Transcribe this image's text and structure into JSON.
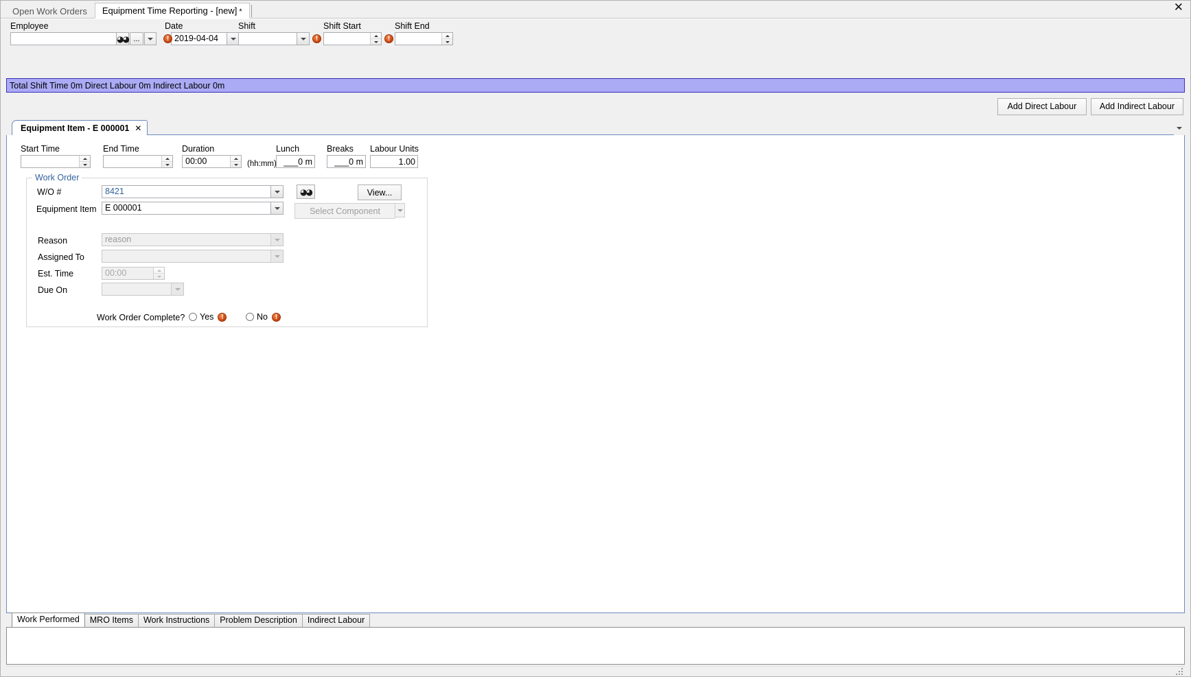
{
  "window": {
    "close_label": "✕"
  },
  "doc_tabs": [
    {
      "label": "Open Work Orders",
      "active": false
    },
    {
      "label": "Equipment Time Reporting - [new]",
      "star": "*",
      "active": true
    }
  ],
  "header": {
    "employee": {
      "label": "Employee",
      "value": "",
      "search_icon": "binoculars-icon",
      "ellipsis_label": "...",
      "dropdown_icon": "chevron-down-icon"
    },
    "date": {
      "label": "Date",
      "value": "2019-04-04",
      "error": "!"
    },
    "shift": {
      "label": "Shift",
      "value": "",
      "error": "!"
    },
    "shift_start": {
      "label": "Shift Start",
      "value": "",
      "error": "!"
    },
    "shift_end": {
      "label": "Shift End",
      "value": ""
    }
  },
  "summary": {
    "text": "Total Shift Time 0m  Direct Labour 0m  Indirect Labour 0m",
    "bg_color": "#aaaaf5",
    "border_color": "#3b2fb6"
  },
  "actions": {
    "add_direct_labour": "Add Direct Labour",
    "add_indirect_labour": "Add Indirect Labour"
  },
  "inner_tab": {
    "label": "Equipment Item - E 000001",
    "close_label": "✕",
    "overflow_icon": "chevron-down-icon"
  },
  "times": {
    "start_time": {
      "label": "Start Time",
      "value": ""
    },
    "end_time": {
      "label": "End Time",
      "value": ""
    },
    "duration": {
      "label": "Duration",
      "value": "00:00",
      "hint": "(hh:mm)"
    },
    "lunch": {
      "label": "Lunch",
      "value": "___0 m"
    },
    "breaks": {
      "label": "Breaks",
      "value": "___0 m"
    },
    "labour_units": {
      "label": "Labour Units",
      "value": "1.00"
    }
  },
  "work_order": {
    "title": "Work Order",
    "wo_number": {
      "label": "W/O #",
      "value": "8421",
      "value_color": "#31639c"
    },
    "search_icon": "binoculars-icon",
    "view_button": "View...",
    "equipment_item": {
      "label": "Equipment Item",
      "value": "E 000001"
    },
    "select_component": {
      "label": "Select Component",
      "disabled": true
    },
    "reason": {
      "label": "Reason",
      "value": "reason",
      "disabled": true
    },
    "assigned_to": {
      "label": "Assigned To",
      "value": "",
      "disabled": true
    },
    "est_time": {
      "label": "Est. Time",
      "value": "00:00",
      "disabled": true
    },
    "due_on": {
      "label": "Due On",
      "value": "",
      "disabled": true
    },
    "complete": {
      "label": "Work Order Complete?",
      "yes_label": "Yes",
      "no_label": "No",
      "yes_error": "!",
      "no_error": "!"
    }
  },
  "bottom_tabs": [
    {
      "label": "Work Performed",
      "active": true
    },
    {
      "label": "MRO Items",
      "active": false
    },
    {
      "label": "Work Instructions",
      "active": false
    },
    {
      "label": "Problem Description",
      "active": false
    },
    {
      "label": "Indirect Labour",
      "active": false
    }
  ],
  "bottom_panel": {
    "value": ""
  }
}
